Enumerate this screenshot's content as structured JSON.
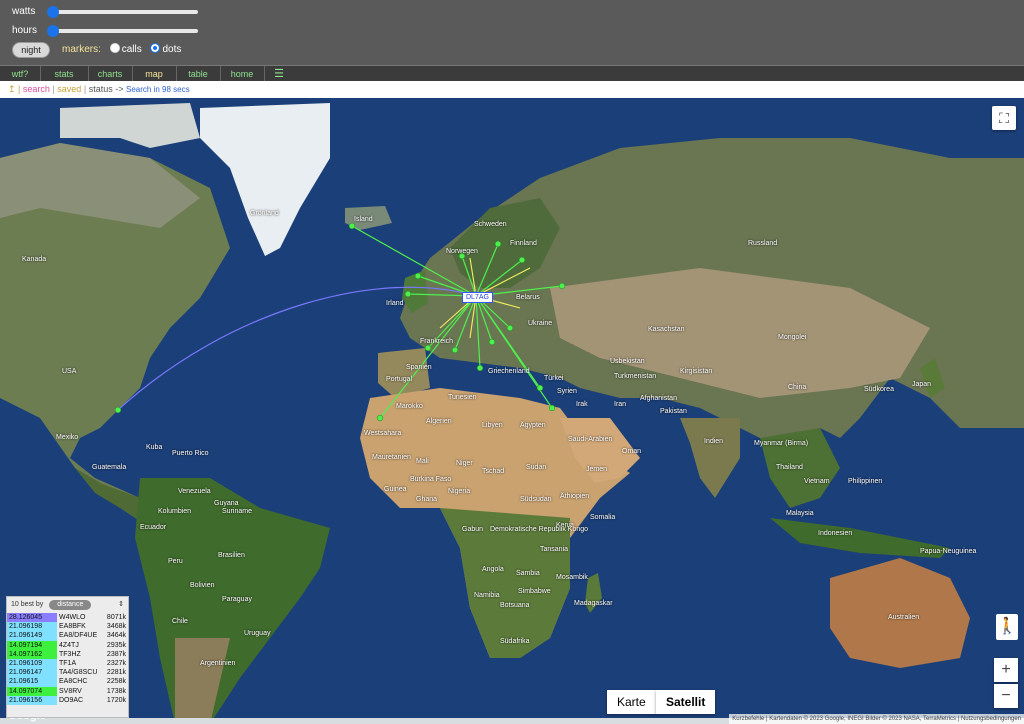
{
  "controls": {
    "watts_label": "watts",
    "hours_label": "hours",
    "night_button": "night",
    "markers_label": "markers:",
    "markers_options": [
      "calls",
      "dots"
    ],
    "markers_selected": "dots",
    "watts_level": 0.03,
    "hours_level": 0.03
  },
  "nav": {
    "items": [
      "wtf?",
      "stats",
      "charts",
      "map",
      "table",
      "home",
      "☰"
    ],
    "active": "map"
  },
  "status": {
    "prefix": "↥ |",
    "search": "search",
    "saved": "saved",
    "status": "status",
    "arrow": "->",
    "message": "Search in 98 secs"
  },
  "map": {
    "center_call": "DL7AG",
    "labels": [
      {
        "t": "Grönland"
      },
      {
        "t": "Island"
      },
      {
        "t": "Kanada"
      },
      {
        "t": "Schweden"
      },
      {
        "t": "Norwegen"
      },
      {
        "t": "Finnland"
      },
      {
        "t": "Russland"
      },
      {
        "t": "Irland"
      },
      {
        "t": "Belarus"
      },
      {
        "t": "Ukraine"
      },
      {
        "t": "Frankreich"
      },
      {
        "t": "Portugal"
      },
      {
        "t": "Spanien"
      },
      {
        "t": "Griechenland"
      },
      {
        "t": "Türkei"
      },
      {
        "t": "Kasachstan"
      },
      {
        "t": "Mongolei"
      },
      {
        "t": "Usbekistan"
      },
      {
        "t": "Turkmenistan"
      },
      {
        "t": "Kirgisistan"
      },
      {
        "t": "China"
      },
      {
        "t": "Südkorea"
      },
      {
        "t": "Japan"
      },
      {
        "t": "Afghanistan"
      },
      {
        "t": "Pakistan"
      },
      {
        "t": "Iran"
      },
      {
        "t": "Irak"
      },
      {
        "t": "Syrien"
      },
      {
        "t": "Marokko"
      },
      {
        "t": "Tunesien"
      },
      {
        "t": "Algerien"
      },
      {
        "t": "Libyen"
      },
      {
        "t": "Ägypten"
      },
      {
        "t": "Saudi-Arabien"
      },
      {
        "t": "Oman"
      },
      {
        "t": "Jemen"
      },
      {
        "t": "Indien"
      },
      {
        "t": "Myanmar (Birma)"
      },
      {
        "t": "Thailand"
      },
      {
        "t": "Vietnam"
      },
      {
        "t": "Philippinen"
      },
      {
        "t": "Malaysia"
      },
      {
        "t": "Indonesien"
      },
      {
        "t": "Papua-Neuguinea"
      },
      {
        "t": "Australien"
      },
      {
        "t": "Westsahara"
      },
      {
        "t": "Mauretanien"
      },
      {
        "t": "Mali"
      },
      {
        "t": "Niger"
      },
      {
        "t": "Tschad"
      },
      {
        "t": "Sudan"
      },
      {
        "t": "Äthiopien"
      },
      {
        "t": "Somalia"
      },
      {
        "t": "Kenia"
      },
      {
        "t": "Südsudan"
      },
      {
        "t": "Nigeria"
      },
      {
        "t": "Ghana"
      },
      {
        "t": "Guinea"
      },
      {
        "t": "Burkina Faso"
      },
      {
        "t": "Gabun"
      },
      {
        "t": "Demokratische Republik Kongo"
      },
      {
        "t": "Tansania"
      },
      {
        "t": "Angola"
      },
      {
        "t": "Sambia"
      },
      {
        "t": "Mosambik"
      },
      {
        "t": "Namibia"
      },
      {
        "t": "Botsuana"
      },
      {
        "t": "Simbabwe"
      },
      {
        "t": "Madagaskar"
      },
      {
        "t": "Südafrika"
      },
      {
        "t": "USA"
      },
      {
        "t": "Mexiko"
      },
      {
        "t": "Kuba"
      },
      {
        "t": "Puerto Rico"
      },
      {
        "t": "Guatemala"
      },
      {
        "t": "Venezuela"
      },
      {
        "t": "Kolumbien"
      },
      {
        "t": "Guyana"
      },
      {
        "t": "Suriname"
      },
      {
        "t": "Ecuador"
      },
      {
        "t": "Peru"
      },
      {
        "t": "Brasilien"
      },
      {
        "t": "Bolivien"
      },
      {
        "t": "Paraguay"
      },
      {
        "t": "Chile"
      },
      {
        "t": "Argentinien"
      },
      {
        "t": "Uruguay"
      }
    ],
    "type_buttons": [
      "Karte",
      "Satellit"
    ],
    "active_type": "Satellit",
    "zoom_in": "+",
    "zoom_out": "−",
    "google": "Google",
    "attribution": [
      "Kurzbefehle",
      "Kartendaten © 2023 Google, INEGI Bilder © 2023 NASA, TerraMetrics",
      "Nutzungsbedingungen"
    ]
  },
  "best": {
    "label": "10 best by",
    "sort": "distance",
    "rows": [
      {
        "freq": "28.126045",
        "call": "W4WLO",
        "dist": "8071k",
        "color": "#8a7dff"
      },
      {
        "freq": "21.096198",
        "call": "EA8BFK",
        "dist": "3468k",
        "color": "#7fe0ff"
      },
      {
        "freq": "21.096149",
        "call": "EA8/DF4UE",
        "dist": "3464k",
        "color": "#7fe0ff"
      },
      {
        "freq": "14.097194",
        "call": "4Z4TJ",
        "dist": "2935k",
        "color": "#3ef03e"
      },
      {
        "freq": "14.097162",
        "call": "TF3HZ",
        "dist": "2387k",
        "color": "#3ef03e"
      },
      {
        "freq": "21.096109",
        "call": "TF1A",
        "dist": "2327k",
        "color": "#7fe0ff"
      },
      {
        "freq": "21.096147",
        "call": "TA4/G8SCU",
        "dist": "2281k",
        "color": "#7fe0ff"
      },
      {
        "freq": "21.09615",
        "call": "EA8CHC",
        "dist": "2258k",
        "color": "#7fe0ff"
      },
      {
        "freq": "14.097074",
        "call": "SV8RV",
        "dist": "1738k",
        "color": "#3ef03e"
      },
      {
        "freq": "21.096156",
        "call": "DO9AC",
        "dist": "1720k",
        "color": "#7fe0ff"
      }
    ]
  }
}
